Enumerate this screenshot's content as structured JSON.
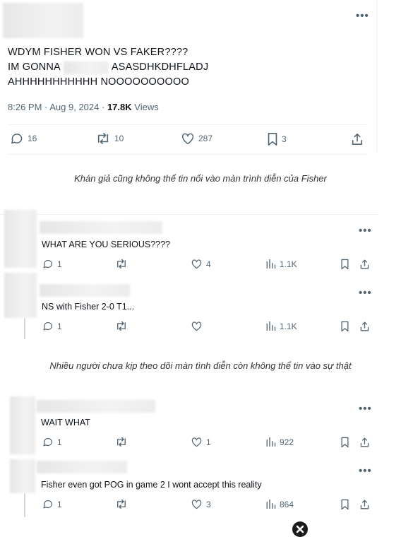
{
  "main_post": {
    "text_line1": "WDYM FISHER WON VS FAKER????",
    "text_line2_start": "IM GONNA",
    "text_line2_end": "ASASDHKDHFLADJ",
    "text_line3": "AHHHHHHHHHHH NOOOOOOOOOO",
    "time": "8:26 PM · Aug 9, 2024 ·",
    "views_count": "17.8K",
    "views_label": "Views",
    "replies": "16",
    "reposts": "10",
    "likes": "287",
    "bookmarks": "3"
  },
  "caption1": "Khán giả cũng không thể tin nổi vào màn trình diễn của Fisher",
  "caption2": "Nhiều người chưa kịp theo dõi màn tình diễn còn không thể tin vào sự thật",
  "thread1": [
    {
      "text": "WHAT ARE YOU SERIOUS????",
      "replies": "1",
      "likes": "4",
      "views": "1.1K"
    },
    {
      "text": "NS with Fisher 2-0 T1...",
      "replies": "1",
      "likes": "",
      "views": "1.1K"
    }
  ],
  "thread2": [
    {
      "text": "WAIT WHAT",
      "replies": "1",
      "likes": "1",
      "views": "922"
    },
    {
      "text": "Fisher even got POG in game 2 I wont accept this reality",
      "replies": "1",
      "likes": "3",
      "views": "864"
    }
  ],
  "more_label": "•••"
}
